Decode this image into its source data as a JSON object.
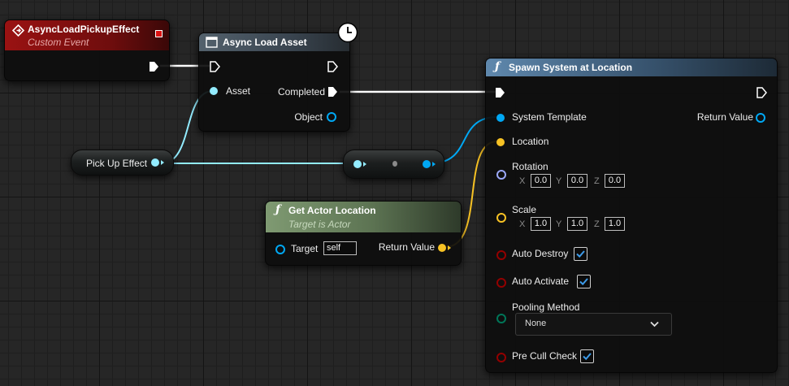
{
  "custom_event": {
    "title": "AsyncLoadPickupEffect",
    "subtitle": "Custom Event"
  },
  "async_load": {
    "title": "Async Load Asset",
    "asset_pin": "Asset",
    "completed_pin": "Completed",
    "object_pin": "Object"
  },
  "pickup_var": {
    "label": "Pick Up Effect"
  },
  "get_actor_location": {
    "title": "Get Actor Location",
    "subtitle": "Target is Actor",
    "target_pin": "Target",
    "target_value": "self",
    "return_pin": "Return Value"
  },
  "spawn_system": {
    "title": "Spawn System at Location",
    "system_template_pin": "System Template",
    "return_pin": "Return Value",
    "location_pin": "Location",
    "rotation_pin": "Rotation",
    "rotation": {
      "x": "0.0",
      "y": "0.0",
      "z": "0.0"
    },
    "scale_pin": "Scale",
    "scale": {
      "x": "1.0",
      "y": "1.0",
      "z": "1.0"
    },
    "axis_labels": {
      "x": "X",
      "y": "Y",
      "z": "Z"
    },
    "auto_destroy_pin": "Auto Destroy",
    "auto_activate_pin": "Auto Activate",
    "pooling_method_pin": "Pooling Method",
    "pooling_method_value": "None",
    "pre_cull_check_pin": "Pre Cull Check"
  },
  "colors": {
    "exec": "#ffffff",
    "object_ref": "#00a8f4",
    "soft_object_ref": "#93ecff",
    "vector": "#f7c224",
    "rotator": "#9ba8f8",
    "bool": "#930000",
    "enum": "#007658",
    "event_header": "#8a1010",
    "function_header": "#2b4a6a",
    "pure_header": "#6e8a64"
  }
}
